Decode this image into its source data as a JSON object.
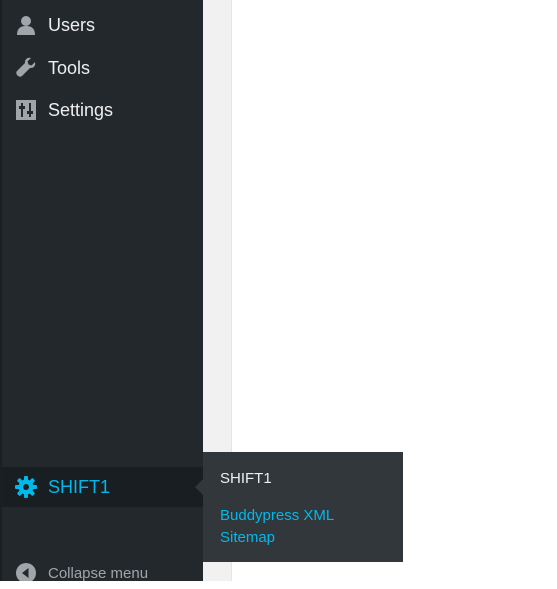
{
  "sidebar": {
    "items": [
      {
        "label": "Users",
        "icon": "user-icon"
      },
      {
        "label": "Tools",
        "icon": "wrench-icon"
      },
      {
        "label": "Settings",
        "icon": "settings-sliders-icon"
      }
    ],
    "active_item": {
      "label": "SHIFT1",
      "icon": "gear-icon"
    },
    "collapse_label": "Collapse menu"
  },
  "flyout": {
    "title": "SHIFT1",
    "link": "Buddypress XML Sitemap"
  },
  "colors": {
    "sidebar_bg": "#23282d",
    "active_bg": "#191e23",
    "flyout_bg": "#32373c",
    "accent": "#00b9eb",
    "text": "#eeeeee",
    "muted": "#a0a5aa"
  }
}
